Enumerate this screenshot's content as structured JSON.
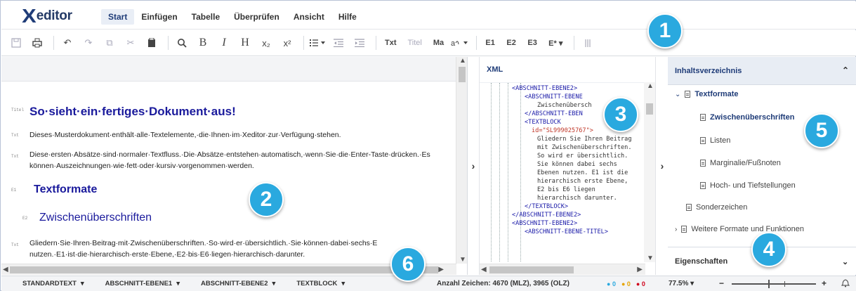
{
  "app": {
    "logo_x": "X",
    "logo_rest": "editor"
  },
  "menu": [
    "Start",
    "Einfügen",
    "Tabelle",
    "Überprüfen",
    "Ansicht",
    "Hilfe"
  ],
  "toolbar": {
    "undo": "↶",
    "redo": "↷",
    "copy": "⧉",
    "cut": "✂",
    "paste": "📋",
    "search": "⌕",
    "bold": "B",
    "italic": "I",
    "heading": "H",
    "sub": "x₂",
    "sup": "x²",
    "txt": "Txt",
    "titel": "Titel",
    "ma": "Ma",
    "e1": "E1",
    "e2": "E2",
    "e3": "E3",
    "estar": "E* ▾"
  },
  "editor": {
    "title": "So·sieht·ein·fertiges·Dokument·aus!",
    "p1": "Dieses·Musterdokument·enthält·alle·Textelemente,·die·Ihnen·im·Xeditor·zur·Verfügung·stehen.",
    "p2a": "Diese·ersten·Absätze·sind·normaler·Textfluss.·Die·Absätze·entstehen·automatisch,·wenn·Sie·die·Enter-Taste·drücken.·Es",
    "p2b": "können·Auszeichnungen·wie·fett·oder·kursiv·vorgenommen·werden.",
    "h_textformate": "Textformate",
    "h_zwischen": "Zwischenüberschriften",
    "p3a": "Gliedern·Sie·Ihren·Beitrag·mit·Zwischenüberschriften.·So·wird·er·übersichtlich.·Sie·können·dabei·sechs·E",
    "p3b": "nutzen.·E1·ist·die·hierarchisch·erste·Ebene,·E2·bis·E6·liegen·hierarchisch·darunter.",
    "marks": [
      "Titel",
      "Txt",
      "Txt",
      "E1",
      "E2",
      "Txt"
    ]
  },
  "xml": {
    "title": "XML",
    "lines": [
      "<ABSCHNITT-EBENE2>",
      "<ABSCHNITT-EBENE",
      "Zwischenübersch",
      "</ABSCHNITT-EBEN",
      "<TEXTBLOCK",
      "id=\"SL999025767\">",
      "Gliedern Sie Ihren Beitrag",
      "mit Zwischenüberschriften.",
      "So wird er übersichtlich.",
      "Sie können dabei sechs",
      "Ebenen nutzen. E1 ist die",
      "hierarchisch erste Ebene,",
      "E2 bis E6 liegen",
      "hierarchisch darunter.",
      "</TEXTBLOCK>",
      "</ABSCHNITT-EBENE2>",
      "<ABSCHNITT-EBENE2>",
      "<ABSCHNITT-EBENE-TITEL>"
    ]
  },
  "toc": {
    "header": "Inhaltsverzeichnis",
    "items": [
      "Textformate",
      "Zwischenüberschriften",
      "Listen",
      "Marginalie/Fußnoten",
      "Hoch- und Tiefstellungen",
      "Sonderzeichen",
      "Weitere Formate und Funktionen"
    ],
    "properties": "Eigenschaften"
  },
  "status": {
    "items": [
      "STANDARDTEXT",
      "ABSCHNITT-EBENE1",
      "ABSCHNITT-EBENE2",
      "TEXTBLOCK"
    ],
    "count": "Anzahl Zeichen: 4670 (MLZ), 3965 (OLZ)",
    "dots": [
      "0",
      "0",
      "0"
    ],
    "zoom": "77.5%",
    "minus": "−",
    "plus": "+"
  },
  "badges": [
    "1",
    "2",
    "3",
    "4",
    "5",
    "6"
  ],
  "colors": {
    "accent": "#1f3c78",
    "badge": "#2aa9df",
    "heading": "#1a1a9c"
  }
}
